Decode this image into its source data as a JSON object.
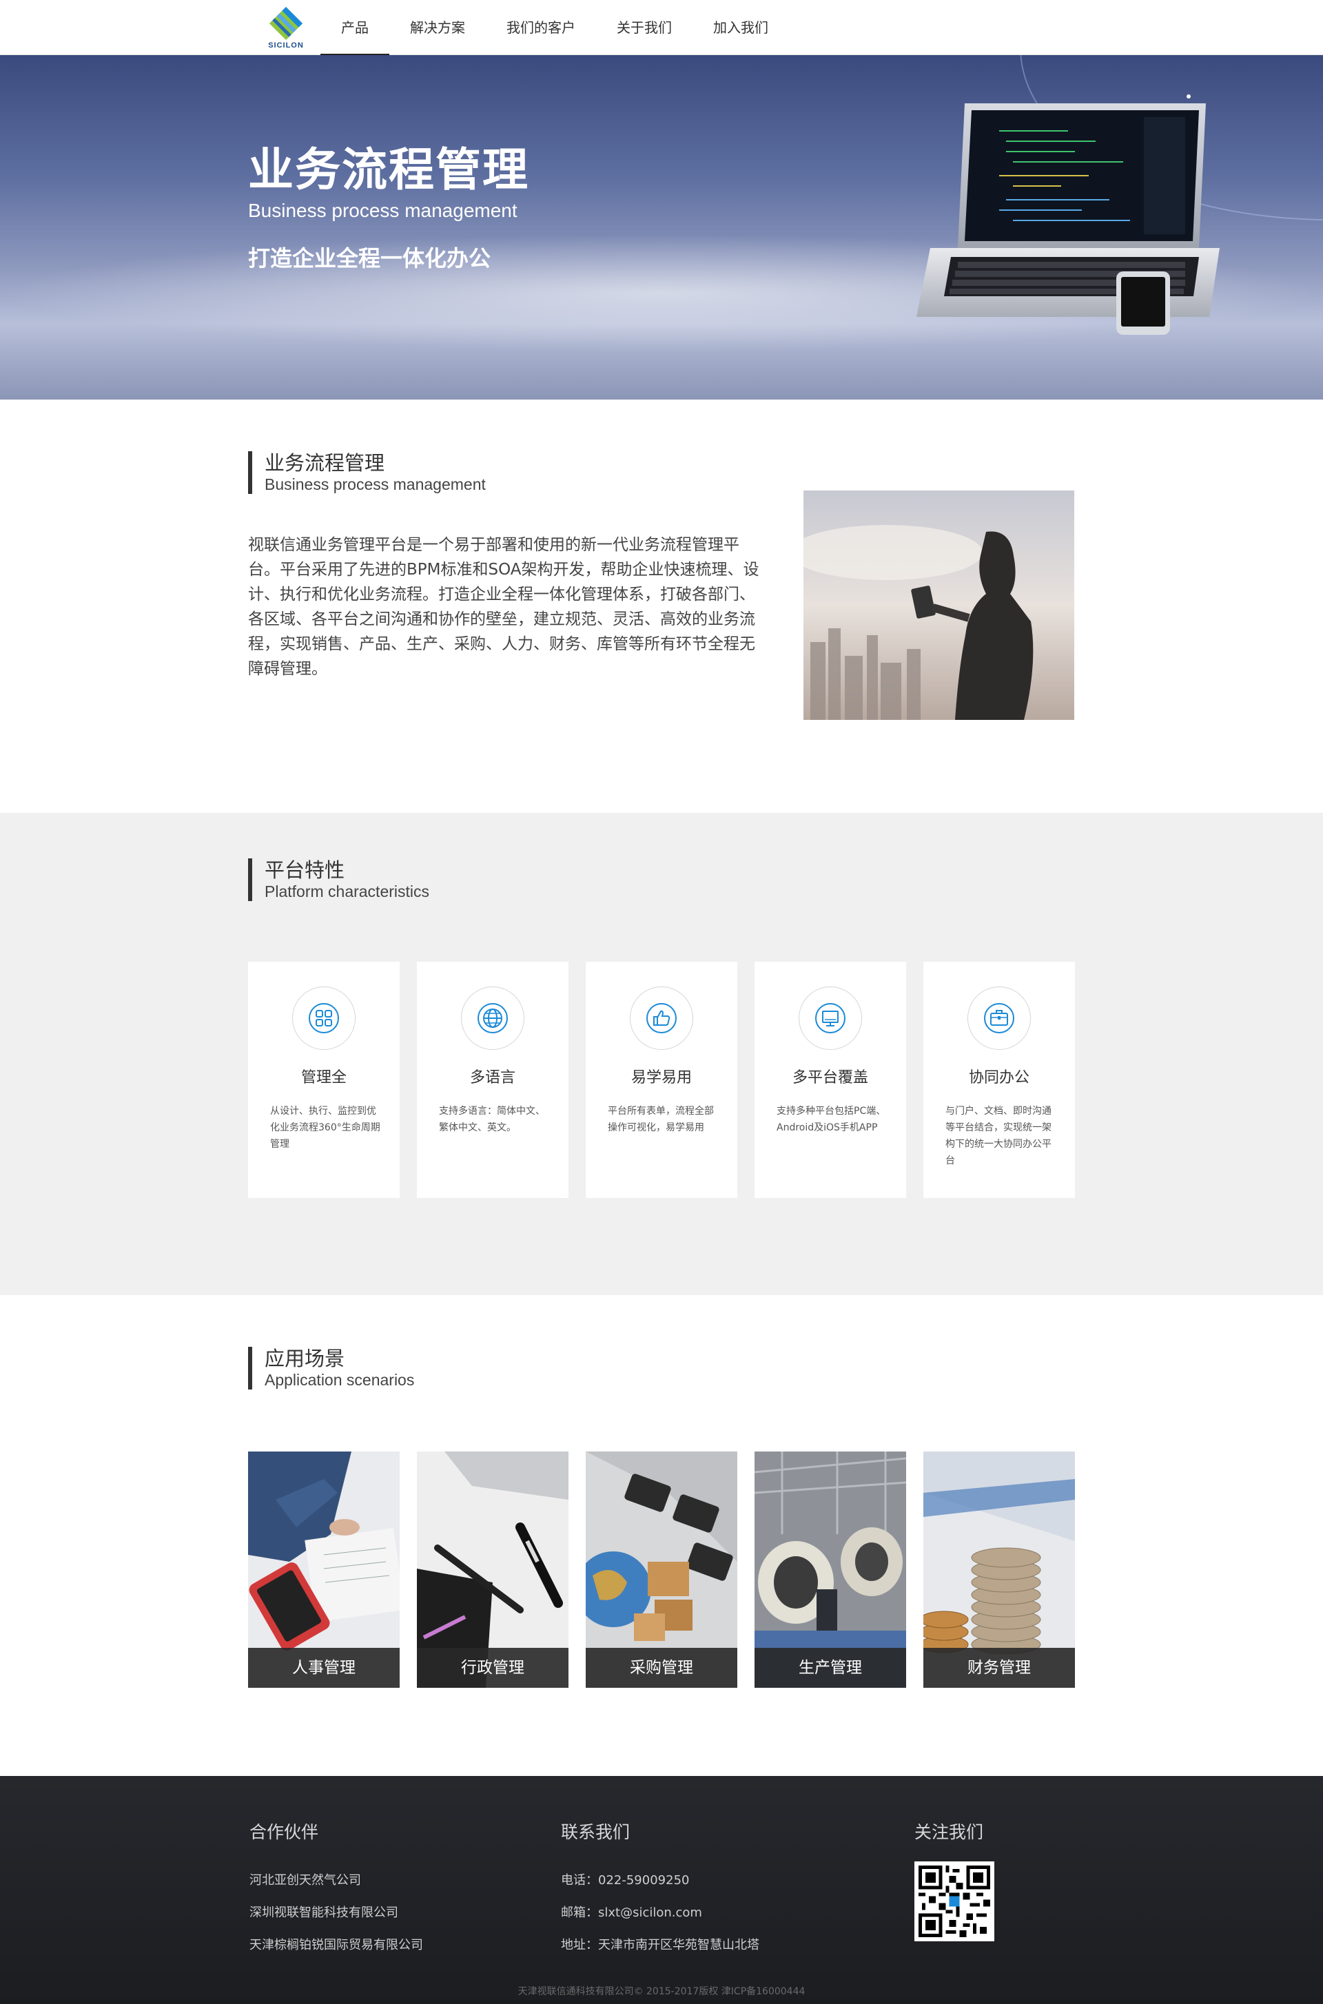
{
  "nav": {
    "logo_text": "SICILON",
    "items": [
      {
        "label": "产品",
        "active": true
      },
      {
        "label": "解决方案"
      },
      {
        "label": "我们的客户"
      },
      {
        "label": "关于我们"
      },
      {
        "label": "加入我们"
      }
    ]
  },
  "hero": {
    "title": "业务流程管理",
    "subtitle_en": "Business process management",
    "slogan": "打造企业全程一体化办公"
  },
  "intro": {
    "heading_zh": "业务流程管理",
    "heading_en": "Business process management",
    "body": "视联信通业务管理平台是一个易于部署和使用的新一代业务流程管理平台。平台采用了先进的BPM标准和SOA架构开发，帮助企业快速梳理、设计、执行和优化业务流程。打造企业全程一体化管理体系，打破各部门、各区域、各平台之间沟通和协作的壁垒，建立规范、灵活、高效的业务流程，实现销售、产品、生产、采购、人力、财务、库管等所有环节全程无障碍管理。"
  },
  "features": {
    "heading_zh": "平台特性",
    "heading_en": "Platform characteristics",
    "cards": [
      {
        "title": "管理全",
        "desc": "从设计、执行、监控到优化业务流程360°生命周期管理",
        "icon": "grid-icon"
      },
      {
        "title": "多语言",
        "desc": "支持多语言：简体中文、繁体中文、英文。",
        "icon": "globe-icon"
      },
      {
        "title": "易学易用",
        "desc": "平台所有表单，流程全部操作可视化，易学易用",
        "icon": "thumbs-up-icon"
      },
      {
        "title": "多平台覆盖",
        "desc": "支持多种平台包括PC端、Android及iOS手机APP",
        "icon": "monitor-icon"
      },
      {
        "title": "协同办公",
        "desc": "与门户、文档、即时沟通等平台结合，实现统一架构下的统一大协同办公平台",
        "icon": "briefcase-icon"
      }
    ]
  },
  "scenarios": {
    "heading_zh": "应用场景",
    "heading_en": "Application scenarios",
    "items": [
      {
        "label": "人事管理"
      },
      {
        "label": "行政管理"
      },
      {
        "label": "采购管理"
      },
      {
        "label": "生产管理"
      },
      {
        "label": "财务管理"
      }
    ]
  },
  "footer": {
    "partners_head": "合作伙伴",
    "partners": [
      "河北亚创天然气公司",
      "深圳视联智能科技有限公司",
      "天津棕榈铂锐国际贸易有限公司"
    ],
    "contact_head": "联系我们",
    "phone": "电话：022-59009250",
    "email": "邮箱：slxt@sicilon.com",
    "address": "地址：天津市南开区华苑智慧山北塔",
    "follow_head": "关注我们",
    "copyright": "天津视联信通科技有限公司© 2015-2017版权 津ICP备16000444"
  },
  "colors": {
    "accent_icon": "#1a8ad8",
    "footer_bg": "#202226",
    "feature_bg": "#f0f0f0"
  }
}
